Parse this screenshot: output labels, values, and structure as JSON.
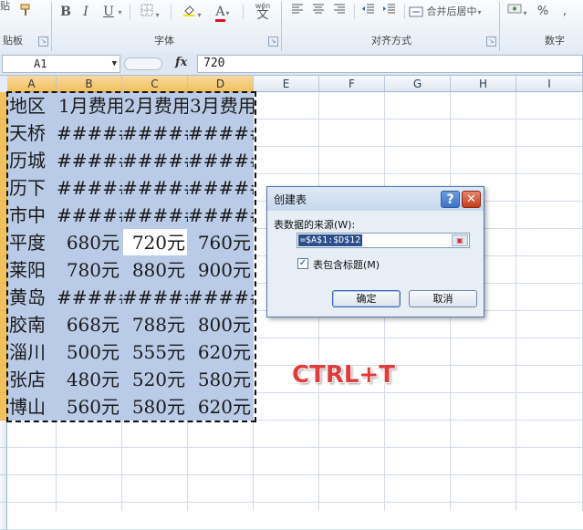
{
  "ribbon": {
    "clipboard_partial_top": "贴",
    "clipboard_partial_label": "贴板",
    "font_group_label": "字体",
    "alignment_group_label": "对齐方式",
    "number_group_label": "数字",
    "bold": "B",
    "italic": "I",
    "underline": "U",
    "font_color": "A",
    "wen_char": "wén",
    "wen_main": "文",
    "merge_center": "合并后居中",
    "percent": "%",
    "comma": ","
  },
  "formula_bar": {
    "cell_ref": "A1",
    "fx": "fx",
    "content": "720"
  },
  "grid": {
    "columns": [
      "A",
      "B",
      "C",
      "D",
      "E",
      "F",
      "G",
      "H",
      "I"
    ],
    "selected_columns": [
      "A",
      "B",
      "C",
      "D"
    ],
    "header_row": [
      "地区",
      "1月费用",
      "2月费用",
      "3月费用"
    ],
    "rows": [
      [
        "天桥",
        "#####",
        "#####",
        "#####"
      ],
      [
        "历城",
        "#####",
        "#####",
        "#####"
      ],
      [
        "历下",
        "#####",
        "#####",
        "#####"
      ],
      [
        "市中",
        "#####",
        "#####",
        "#####"
      ],
      [
        "平度",
        "680元",
        "720元",
        "760元"
      ],
      [
        "莱阳",
        "780元",
        "880元",
        "900元"
      ],
      [
        "黄岛",
        "#####",
        "#####",
        "#####"
      ],
      [
        "胶南",
        "668元",
        "788元",
        "800元"
      ],
      [
        "淄川",
        "500元",
        "555元",
        "620元"
      ],
      [
        "张店",
        "480元",
        "520元",
        "580元"
      ],
      [
        "博山",
        "560元",
        "580元",
        "620元"
      ]
    ]
  },
  "dialog": {
    "title": "创建表",
    "help": "?",
    "close": "✕",
    "source_label": "表数据的来源(W):",
    "range": "=$A$1:$D$12",
    "has_headers_label": "表包含标题(M)",
    "has_headers_checked": true,
    "ok": "确定",
    "cancel": "取消"
  },
  "annotation": {
    "shortcut": "CTRL+T"
  }
}
